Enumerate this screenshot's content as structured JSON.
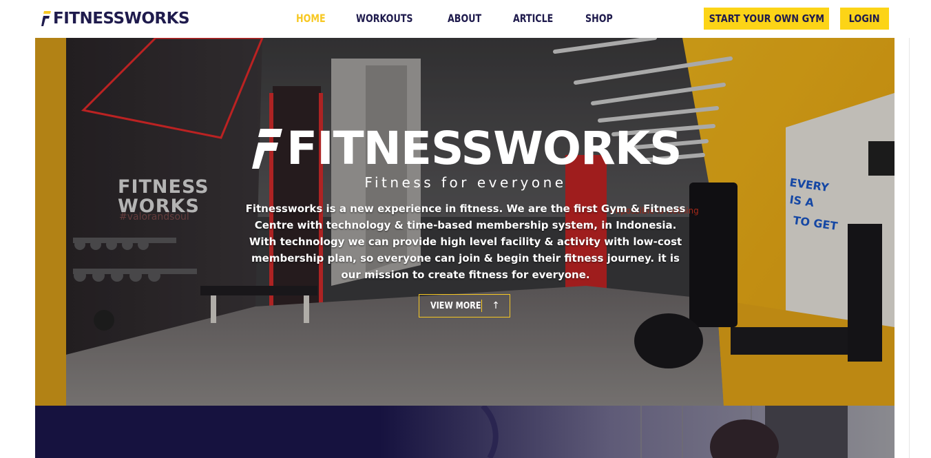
{
  "header": {
    "brand": "FITNESSWORKS",
    "nav": [
      {
        "label": "HOME",
        "active": true
      },
      {
        "label": "WORKOUTS",
        "active": false
      },
      {
        "label": "ABOUT",
        "active": false
      },
      {
        "label": "ARTICLE",
        "active": false
      },
      {
        "label": "SHOP",
        "active": false
      }
    ],
    "start_gym_label": "START YOUR OWN GYM",
    "login_label": "LOGIN"
  },
  "hero": {
    "brand": "FITNESSWORKS",
    "tagline": "Fitness for everyone",
    "description": "Fitnessworks is a new experience in fitness. We are the first Gym & Fitness Centre with technology & time-based membership system, in Indonesia. With technology we can provide high level facility & activity with low-cost membership plan, so everyone can join & begin their fitness journey. it is our mission to create fitness for everyone.",
    "view_more_label": "VIEW MORE",
    "view_more_icon": "arrow-up-icon",
    "wall_sign": "FITNESS WORKS",
    "wall_hashtag": "#valorandsoul",
    "wall_quote": "Impossible is Nothing"
  },
  "colors": {
    "brand_navy": "#1f1b4d",
    "accent_yellow": "#fcd417",
    "active_nav": "#f7c823",
    "section_navy": "#16123f"
  }
}
